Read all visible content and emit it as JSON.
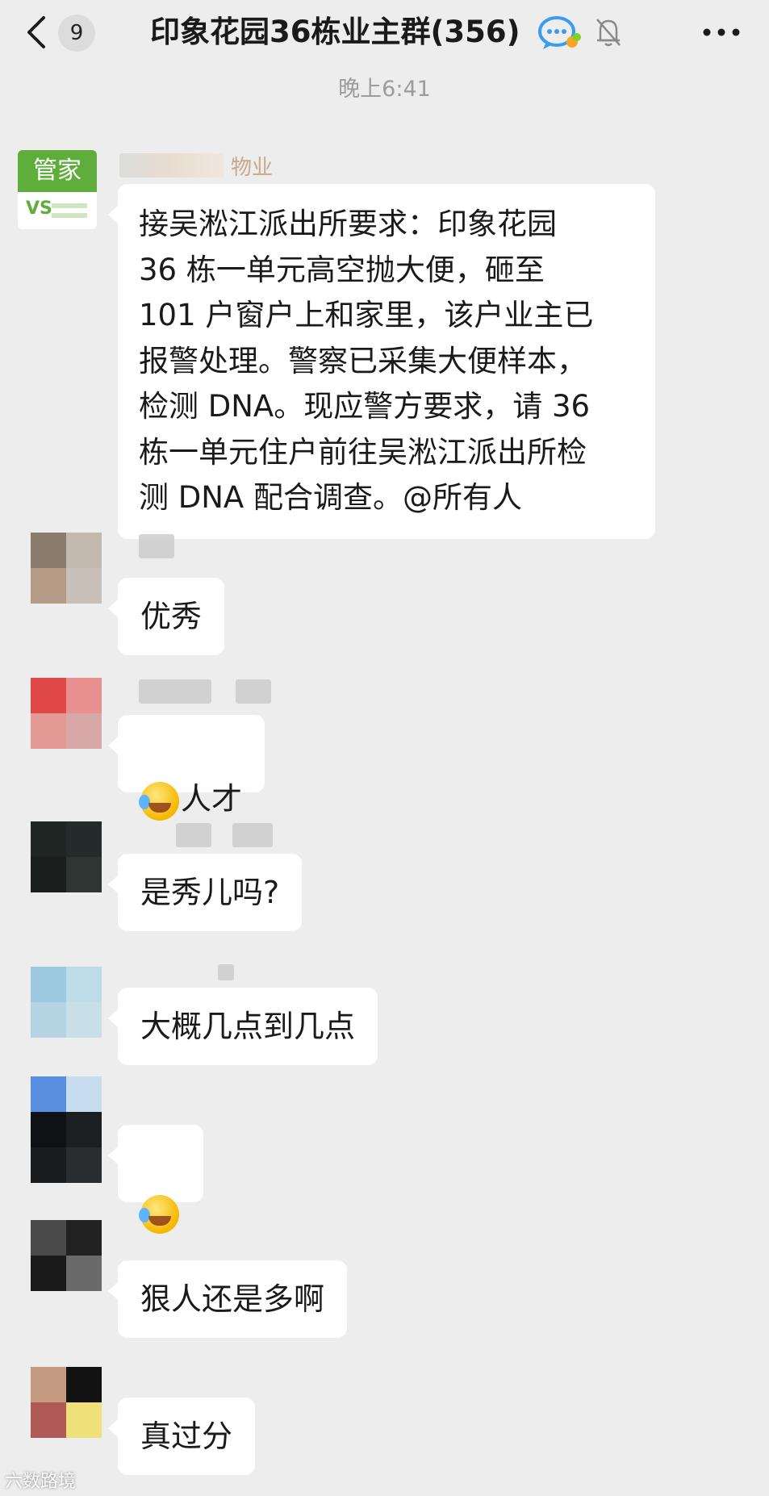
{
  "header": {
    "back_icon": "chevron-left-icon",
    "unread_count": "9",
    "title": "印象花园36栋业主群(356)",
    "chat_icon": "group-chat-icon",
    "mute_icon": "bell-muted-icon",
    "more_icon": "more-dots-icon"
  },
  "timestamp": "晚上6:41",
  "messages": [
    {
      "sender_suffix": "物业",
      "avatar_label": "管家",
      "avatar_brand_mark": "VS",
      "text": "接吴淞江派出所要求：印象花园\n36 栋一单元高空抛大便，砸至\n101 户窗户上和家里，该户业主已\n报警处理。警察已采集大便样本，\n检测 DNA。现应警方要求，请 36\n栋一单元住户前往吴淞江派出所检\n测 DNA 配合调查。@所有人"
    },
    {
      "text": "优秀"
    },
    {
      "text": "人才",
      "emoji": "laughing-crying-emoji"
    },
    {
      "text": "是秀儿吗?"
    },
    {
      "text": "大概几点到几点"
    },
    {
      "text": "",
      "emoji": "laughing-crying-emoji"
    },
    {
      "text": "狠人还是多啊"
    },
    {
      "text": "真过分"
    }
  ],
  "watermark": "六数路境",
  "colors": {
    "background": "#ededed",
    "bubble": "#ffffff",
    "brand_green": "#5fae3c",
    "timestamp": "#9c9c9c"
  }
}
